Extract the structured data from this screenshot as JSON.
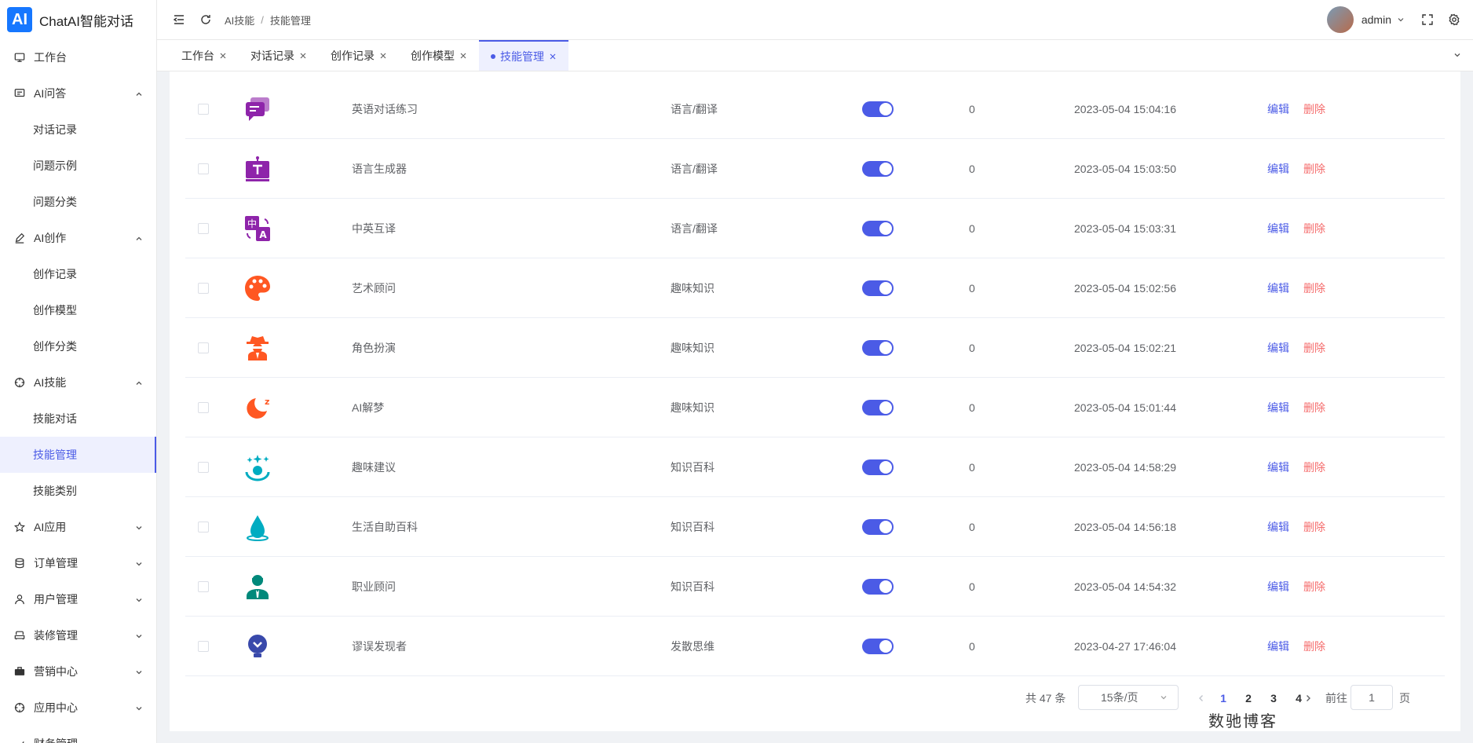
{
  "brand": {
    "logo": "AI",
    "name": "ChatAI智能对话"
  },
  "sidebar": {
    "items": [
      {
        "label": "工作台",
        "icon": "monitor-icon",
        "type": "item"
      },
      {
        "label": "AI问答",
        "icon": "chat-icon",
        "type": "group",
        "expanded": true
      },
      {
        "label": "对话记录",
        "type": "sub"
      },
      {
        "label": "问题示例",
        "type": "sub"
      },
      {
        "label": "问题分类",
        "type": "sub"
      },
      {
        "label": "AI创作",
        "icon": "pen-icon",
        "type": "group",
        "expanded": true
      },
      {
        "label": "创作记录",
        "type": "sub"
      },
      {
        "label": "创作模型",
        "type": "sub"
      },
      {
        "label": "创作分类",
        "type": "sub"
      },
      {
        "label": "AI技能",
        "icon": "target-icon",
        "type": "group",
        "expanded": true
      },
      {
        "label": "技能对话",
        "type": "sub"
      },
      {
        "label": "技能管理",
        "type": "sub",
        "active": true
      },
      {
        "label": "技能类别",
        "type": "sub"
      },
      {
        "label": "AI应用",
        "icon": "star-icon",
        "type": "group",
        "expanded": false
      },
      {
        "label": "订单管理",
        "icon": "database-icon",
        "type": "group",
        "expanded": false
      },
      {
        "label": "用户管理",
        "icon": "user-icon",
        "type": "group",
        "expanded": false
      },
      {
        "label": "装修管理",
        "icon": "sofa-icon",
        "type": "group",
        "expanded": false
      },
      {
        "label": "营销中心",
        "icon": "briefcase-icon",
        "type": "group",
        "expanded": false
      },
      {
        "label": "应用中心",
        "icon": "target-icon",
        "type": "group",
        "expanded": false
      },
      {
        "label": "财务管理",
        "icon": "chart-icon",
        "type": "group",
        "expanded": false
      }
    ]
  },
  "header": {
    "breadcrumb": [
      "AI技能",
      "技能管理"
    ],
    "username": "admin"
  },
  "tabs": [
    {
      "label": "工作台",
      "active": false
    },
    {
      "label": "对话记录",
      "active": false
    },
    {
      "label": "创作记录",
      "active": false
    },
    {
      "label": "创作模型",
      "active": false
    },
    {
      "label": "技能管理",
      "active": true
    }
  ],
  "table": {
    "rows": [
      {
        "name": "英语对话练习",
        "category": "语言/翻译",
        "enabled": true,
        "count": "0",
        "time": "2023-05-04 15:04:16",
        "icon": "chat-bubbles-icon",
        "color": "#8e24aa"
      },
      {
        "name": "语言生成器",
        "category": "语言/翻译",
        "enabled": true,
        "count": "0",
        "time": "2023-05-04 15:03:50",
        "icon": "text-screen-icon",
        "color": "#8e24aa"
      },
      {
        "name": "中英互译",
        "category": "语言/翻译",
        "enabled": true,
        "count": "0",
        "time": "2023-05-04 15:03:31",
        "icon": "translate-icon",
        "color": "#8e24aa"
      },
      {
        "name": "艺术顾问",
        "category": "趣味知识",
        "enabled": true,
        "count": "0",
        "time": "2023-05-04 15:02:56",
        "icon": "palette-icon",
        "color": "#ff5722"
      },
      {
        "name": "角色扮演",
        "category": "趣味知识",
        "enabled": true,
        "count": "0",
        "time": "2023-05-04 15:02:21",
        "icon": "detective-icon",
        "color": "#ff5722"
      },
      {
        "name": "AI解梦",
        "category": "趣味知识",
        "enabled": true,
        "count": "0",
        "time": "2023-05-04 15:01:44",
        "icon": "moon-sleep-icon",
        "color": "#ff5722"
      },
      {
        "name": "趣味建议",
        "category": "知识百科",
        "enabled": true,
        "count": "0",
        "time": "2023-05-04 14:58:29",
        "icon": "sparkle-face-icon",
        "color": "#00acc1"
      },
      {
        "name": "生活自助百科",
        "category": "知识百科",
        "enabled": true,
        "count": "0",
        "time": "2023-05-04 14:56:18",
        "icon": "water-drop-icon",
        "color": "#00acc1"
      },
      {
        "name": "职业顾问",
        "category": "知识百科",
        "enabled": true,
        "count": "0",
        "time": "2023-05-04 14:54:32",
        "icon": "businessman-icon",
        "color": "#00897b"
      },
      {
        "name": "谬误发现者",
        "category": "发散思维",
        "enabled": true,
        "count": "0",
        "time": "2023-04-27 17:46:04",
        "icon": "lightbulb-icon",
        "color": "#3949ab"
      }
    ],
    "edit_label": "编辑",
    "delete_label": "删除"
  },
  "pagination": {
    "total_label": "共 47 条",
    "page_size": "15条/页",
    "pages": [
      "1",
      "2",
      "3",
      "4"
    ],
    "current": "1",
    "goto_label": "前往",
    "goto_value": "1",
    "page_suffix": "页"
  },
  "watermark": "数驰博客",
  "colors": {
    "primary": "#4b5be6",
    "danger": "#f56c6c",
    "brand": "#1677ff"
  }
}
